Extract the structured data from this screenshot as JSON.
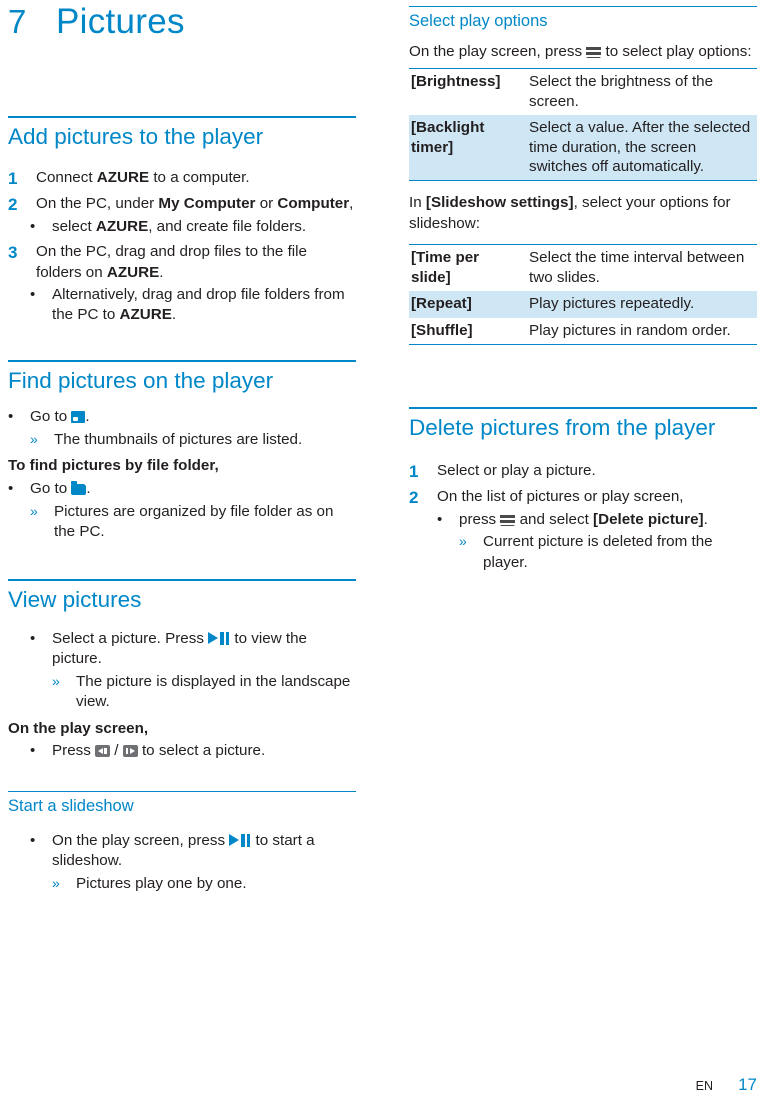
{
  "chapter": {
    "number": "7",
    "title": "Pictures"
  },
  "left": {
    "sections": [
      {
        "heading": "Add pictures to the player",
        "steps": [
          {
            "n": "1",
            "text_pre": "Connect ",
            "bold": "AZURE",
            "text_post": " to a computer."
          },
          {
            "n": "2",
            "text": "On the PC, under My Computer or Computer,"
          }
        ],
        "step2_bullets": [
          "select AZURE, and create file folders."
        ],
        "step3": {
          "n": "3",
          "text": "On the PC, drag and drop files to the file folders on AZURE."
        },
        "step3_bullets": [
          "Alternatively, drag and drop file folders from the PC to AZURE."
        ]
      },
      {
        "heading": "Find pictures on the player",
        "bullet1": "Go to ",
        "result1": "The thumbnails of pictures are listed.",
        "subheading_bold": "To find pictures by file folder,",
        "bullet2": "Go to ",
        "result2": "Pictures are organized by file folder as on the PC."
      },
      {
        "heading": "View pictures",
        "bullet1_a": "Select a picture. Press ",
        "bullet1_b": " to view the picture.",
        "result1": "The picture is displayed in the landscape view.",
        "subheading_bold": "On the play screen,",
        "bullet2_a": "Press ",
        "bullet2_sep": " / ",
        "bullet2_b": " to select a picture."
      },
      {
        "subheading": "Start a slideshow",
        "bullet1_a": "On the play screen, press ",
        "bullet1_b": " to start a slideshow.",
        "result1": "Pictures play one by one."
      }
    ]
  },
  "right": {
    "play_options": {
      "heading": "Select play options",
      "intro_a": "On the play screen, press ",
      "intro_b": " to select play options:",
      "table1": [
        {
          "key": "[Brightness]",
          "value": "Select the brightness of the screen.",
          "shaded": false
        },
        {
          "key": "[Backlight timer]",
          "value": "Select a value. After the selected time duration, the screen switches off automatically.",
          "shaded": true
        }
      ],
      "mid_text_a": "In ",
      "mid_text_bold": "[Slideshow settings]",
      "mid_text_b": ", select your options for slideshow:",
      "table2": [
        {
          "key": "[Time per slide]",
          "value": "Select the time interval between two slides.",
          "shaded": false
        },
        {
          "key": "[Repeat]",
          "value": "Play pictures repeatedly.",
          "shaded": true
        },
        {
          "key": "[Shuffle]",
          "value": "Play pictures in random order.",
          "shaded": false
        }
      ]
    },
    "delete": {
      "heading": "Delete pictures from the player",
      "steps": [
        {
          "n": "1",
          "text": "Select or play a picture."
        },
        {
          "n": "2",
          "text": "On the list of pictures or play screen,"
        }
      ],
      "bullet_a": "press ",
      "bullet_b": " and select ",
      "bullet_bold": "[Delete picture]",
      "bullet_c": ".",
      "result": "Current picture is deleted from the player."
    }
  },
  "footer": {
    "locale": "EN",
    "page": "17"
  }
}
